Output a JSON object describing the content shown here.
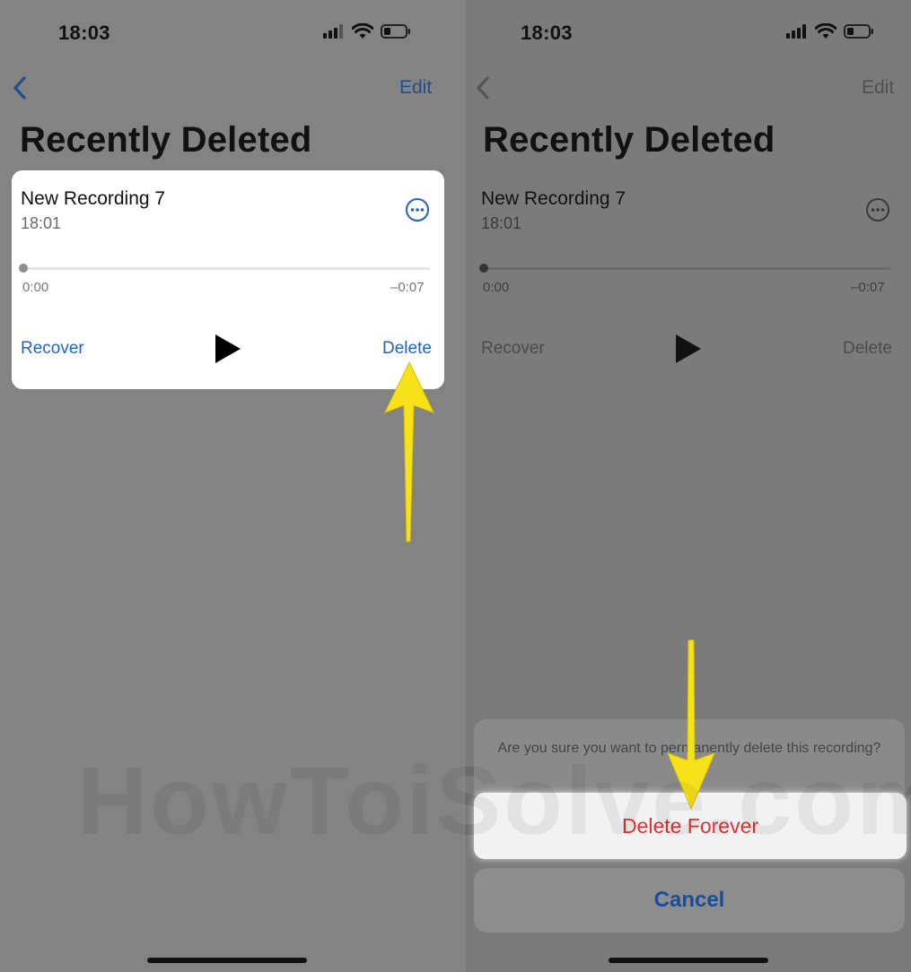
{
  "status_bar": {
    "time": "18:03"
  },
  "nav": {
    "edit_label": "Edit"
  },
  "page": {
    "title": "Recently Deleted"
  },
  "recording": {
    "title": "New Recording 7",
    "time": "18:01",
    "elapsed": "0:00",
    "remaining": "–0:07",
    "recover_label": "Recover",
    "delete_label": "Delete"
  },
  "action_sheet": {
    "message": "Are you sure you want to permanently delete this recording?",
    "delete_forever_label": "Delete Forever",
    "cancel_label": "Cancel"
  },
  "watermark": "HowToiSolve.com",
  "colors": {
    "accent_blue": "#1e64c8",
    "destructive_red": "#e63030",
    "highlight_arrow": "#f7e21a"
  },
  "icons": [
    "chevron-left-icon",
    "ellipsis-circle-icon",
    "play-icon",
    "signal-icon",
    "wifi-icon",
    "battery-icon",
    "arrow-up-icon",
    "arrow-down-icon"
  ]
}
